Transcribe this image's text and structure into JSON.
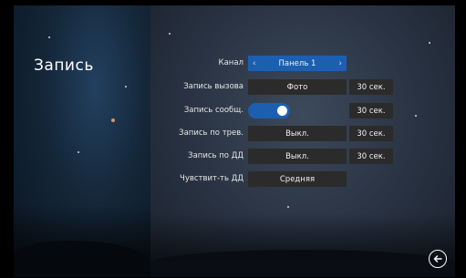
{
  "page": {
    "title": "Запись"
  },
  "rows": [
    {
      "label": "Канал",
      "value": "Панель 1"
    },
    {
      "label": "Запись вызова",
      "value": "Фото",
      "duration": "30 сек."
    },
    {
      "label": "Запись сообщ.",
      "toggle": "on",
      "duration": "30 сек."
    },
    {
      "label": "Запись по трев.",
      "value": "Выкл.",
      "duration": "30 сек."
    },
    {
      "label": "Запись по ДД",
      "value": "Выкл.",
      "duration": "30 сек."
    },
    {
      "label": "Чувствит-ть ДД",
      "value": "Средняя"
    }
  ],
  "arrows": {
    "left": "‹",
    "right": "›"
  },
  "colors": {
    "accent": "#1c5fb0",
    "box": "#2b2b2b"
  },
  "icons": {
    "back": "back-arrow-icon"
  }
}
